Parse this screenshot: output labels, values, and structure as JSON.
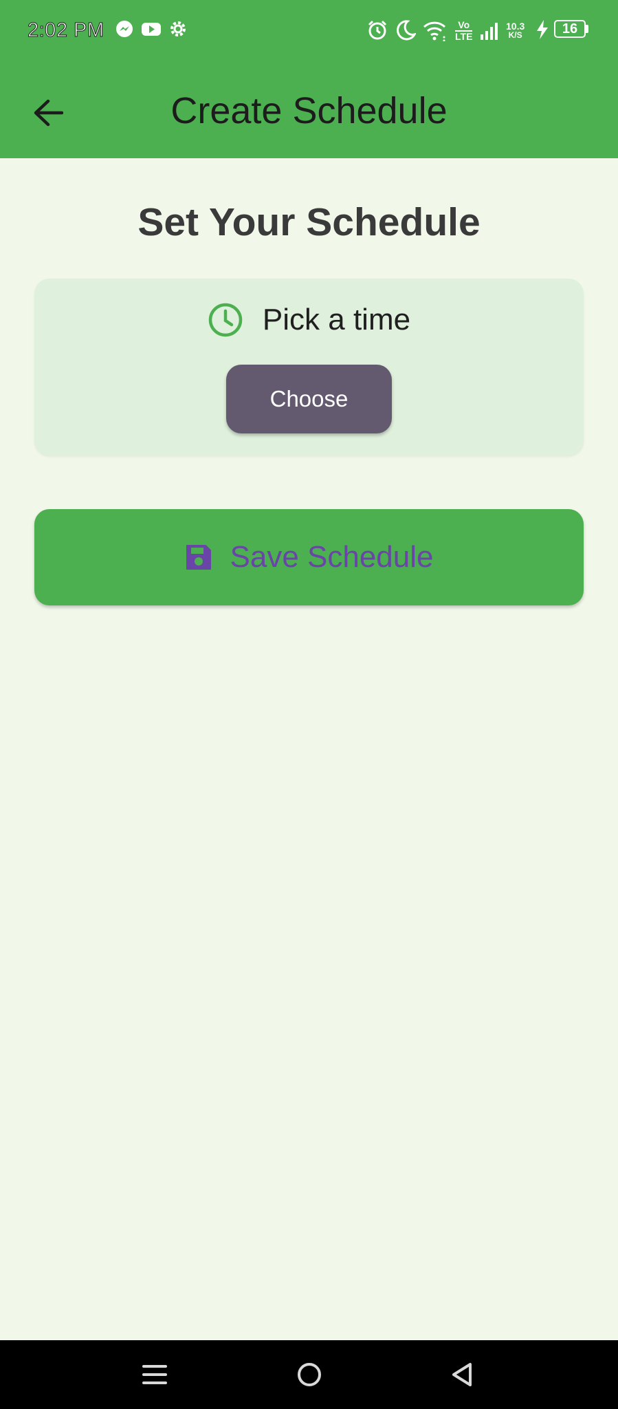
{
  "status_bar": {
    "time": "2:02 PM",
    "left_icons": [
      "messenger-icon",
      "youtube-icon",
      "settings-gear-icon"
    ],
    "right_icons": [
      "alarm-icon",
      "do-not-disturb-moon-icon",
      "wifi-icon",
      "volte-icon",
      "signal-icon",
      "network-speed",
      "charging-bolt-icon",
      "battery-icon"
    ],
    "volte_top": "Vo",
    "volte_bottom": "LTE",
    "speed_value": "10.3",
    "speed_unit": "K/S",
    "battery": "16"
  },
  "app_bar": {
    "title": "Create Schedule",
    "back_icon": "arrow-back-icon"
  },
  "main": {
    "heading": "Set Your Schedule",
    "time_card": {
      "icon": "clock-icon",
      "label": "Pick a time",
      "button_label": "Choose"
    },
    "save_button": {
      "icon": "save-icon",
      "label": "Save Schedule"
    }
  },
  "nav_bar": {
    "items": [
      "menu-icon",
      "home-icon",
      "back-triangle-icon"
    ]
  },
  "colors": {
    "primary": "#4caf50",
    "background": "#f1f7e9",
    "card": "#dff0dc",
    "choose_button": "#635a70",
    "save_label": "#6a45a8"
  }
}
